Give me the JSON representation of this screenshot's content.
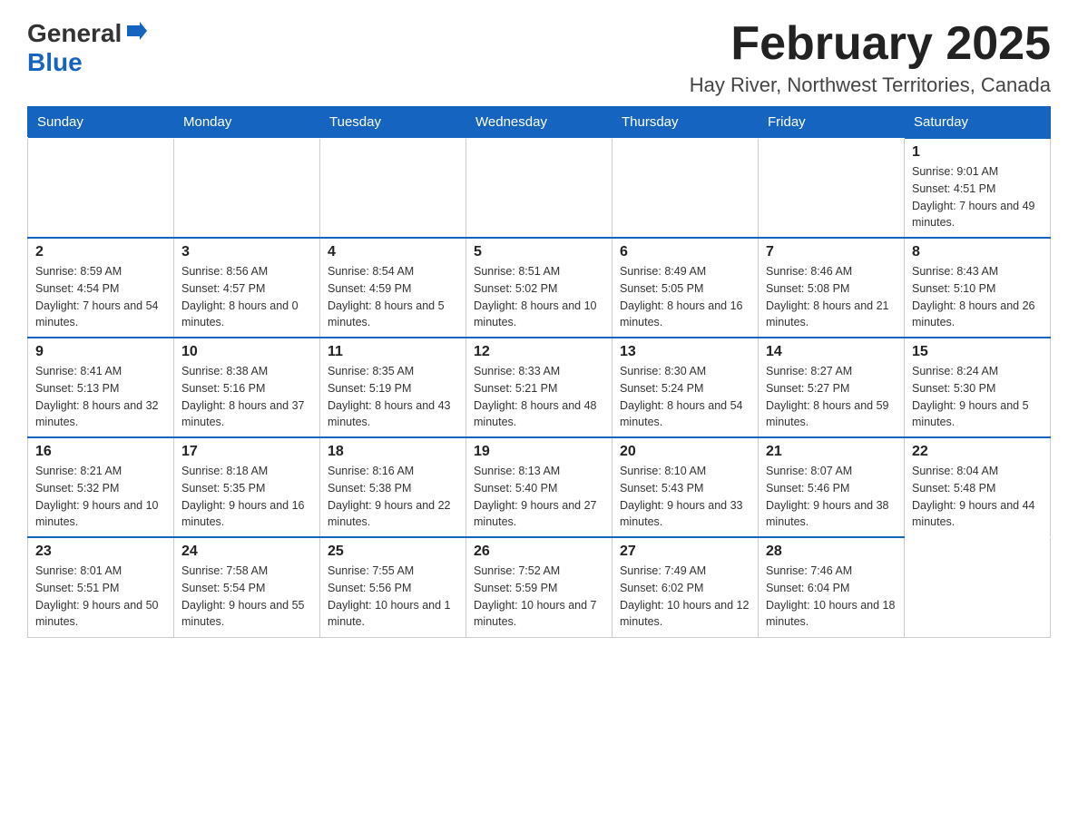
{
  "header": {
    "logo_general": "General",
    "logo_blue": "Blue",
    "title": "February 2025",
    "subtitle": "Hay River, Northwest Territories, Canada"
  },
  "days_of_week": [
    "Sunday",
    "Monday",
    "Tuesday",
    "Wednesday",
    "Thursday",
    "Friday",
    "Saturday"
  ],
  "weeks": [
    [
      null,
      null,
      null,
      null,
      null,
      null,
      {
        "day": "1",
        "sunrise": "Sunrise: 9:01 AM",
        "sunset": "Sunset: 4:51 PM",
        "daylight": "Daylight: 7 hours and 49 minutes."
      }
    ],
    [
      {
        "day": "2",
        "sunrise": "Sunrise: 8:59 AM",
        "sunset": "Sunset: 4:54 PM",
        "daylight": "Daylight: 7 hours and 54 minutes."
      },
      {
        "day": "3",
        "sunrise": "Sunrise: 8:56 AM",
        "sunset": "Sunset: 4:57 PM",
        "daylight": "Daylight: 8 hours and 0 minutes."
      },
      {
        "day": "4",
        "sunrise": "Sunrise: 8:54 AM",
        "sunset": "Sunset: 4:59 PM",
        "daylight": "Daylight: 8 hours and 5 minutes."
      },
      {
        "day": "5",
        "sunrise": "Sunrise: 8:51 AM",
        "sunset": "Sunset: 5:02 PM",
        "daylight": "Daylight: 8 hours and 10 minutes."
      },
      {
        "day": "6",
        "sunrise": "Sunrise: 8:49 AM",
        "sunset": "Sunset: 5:05 PM",
        "daylight": "Daylight: 8 hours and 16 minutes."
      },
      {
        "day": "7",
        "sunrise": "Sunrise: 8:46 AM",
        "sunset": "Sunset: 5:08 PM",
        "daylight": "Daylight: 8 hours and 21 minutes."
      },
      {
        "day": "8",
        "sunrise": "Sunrise: 8:43 AM",
        "sunset": "Sunset: 5:10 PM",
        "daylight": "Daylight: 8 hours and 26 minutes."
      }
    ],
    [
      {
        "day": "9",
        "sunrise": "Sunrise: 8:41 AM",
        "sunset": "Sunset: 5:13 PM",
        "daylight": "Daylight: 8 hours and 32 minutes."
      },
      {
        "day": "10",
        "sunrise": "Sunrise: 8:38 AM",
        "sunset": "Sunset: 5:16 PM",
        "daylight": "Daylight: 8 hours and 37 minutes."
      },
      {
        "day": "11",
        "sunrise": "Sunrise: 8:35 AM",
        "sunset": "Sunset: 5:19 PM",
        "daylight": "Daylight: 8 hours and 43 minutes."
      },
      {
        "day": "12",
        "sunrise": "Sunrise: 8:33 AM",
        "sunset": "Sunset: 5:21 PM",
        "daylight": "Daylight: 8 hours and 48 minutes."
      },
      {
        "day": "13",
        "sunrise": "Sunrise: 8:30 AM",
        "sunset": "Sunset: 5:24 PM",
        "daylight": "Daylight: 8 hours and 54 minutes."
      },
      {
        "day": "14",
        "sunrise": "Sunrise: 8:27 AM",
        "sunset": "Sunset: 5:27 PM",
        "daylight": "Daylight: 8 hours and 59 minutes."
      },
      {
        "day": "15",
        "sunrise": "Sunrise: 8:24 AM",
        "sunset": "Sunset: 5:30 PM",
        "daylight": "Daylight: 9 hours and 5 minutes."
      }
    ],
    [
      {
        "day": "16",
        "sunrise": "Sunrise: 8:21 AM",
        "sunset": "Sunset: 5:32 PM",
        "daylight": "Daylight: 9 hours and 10 minutes."
      },
      {
        "day": "17",
        "sunrise": "Sunrise: 8:18 AM",
        "sunset": "Sunset: 5:35 PM",
        "daylight": "Daylight: 9 hours and 16 minutes."
      },
      {
        "day": "18",
        "sunrise": "Sunrise: 8:16 AM",
        "sunset": "Sunset: 5:38 PM",
        "daylight": "Daylight: 9 hours and 22 minutes."
      },
      {
        "day": "19",
        "sunrise": "Sunrise: 8:13 AM",
        "sunset": "Sunset: 5:40 PM",
        "daylight": "Daylight: 9 hours and 27 minutes."
      },
      {
        "day": "20",
        "sunrise": "Sunrise: 8:10 AM",
        "sunset": "Sunset: 5:43 PM",
        "daylight": "Daylight: 9 hours and 33 minutes."
      },
      {
        "day": "21",
        "sunrise": "Sunrise: 8:07 AM",
        "sunset": "Sunset: 5:46 PM",
        "daylight": "Daylight: 9 hours and 38 minutes."
      },
      {
        "day": "22",
        "sunrise": "Sunrise: 8:04 AM",
        "sunset": "Sunset: 5:48 PM",
        "daylight": "Daylight: 9 hours and 44 minutes."
      }
    ],
    [
      {
        "day": "23",
        "sunrise": "Sunrise: 8:01 AM",
        "sunset": "Sunset: 5:51 PM",
        "daylight": "Daylight: 9 hours and 50 minutes."
      },
      {
        "day": "24",
        "sunrise": "Sunrise: 7:58 AM",
        "sunset": "Sunset: 5:54 PM",
        "daylight": "Daylight: 9 hours and 55 minutes."
      },
      {
        "day": "25",
        "sunrise": "Sunrise: 7:55 AM",
        "sunset": "Sunset: 5:56 PM",
        "daylight": "Daylight: 10 hours and 1 minute."
      },
      {
        "day": "26",
        "sunrise": "Sunrise: 7:52 AM",
        "sunset": "Sunset: 5:59 PM",
        "daylight": "Daylight: 10 hours and 7 minutes."
      },
      {
        "day": "27",
        "sunrise": "Sunrise: 7:49 AM",
        "sunset": "Sunset: 6:02 PM",
        "daylight": "Daylight: 10 hours and 12 minutes."
      },
      {
        "day": "28",
        "sunrise": "Sunrise: 7:46 AM",
        "sunset": "Sunset: 6:04 PM",
        "daylight": "Daylight: 10 hours and 18 minutes."
      },
      null
    ]
  ]
}
